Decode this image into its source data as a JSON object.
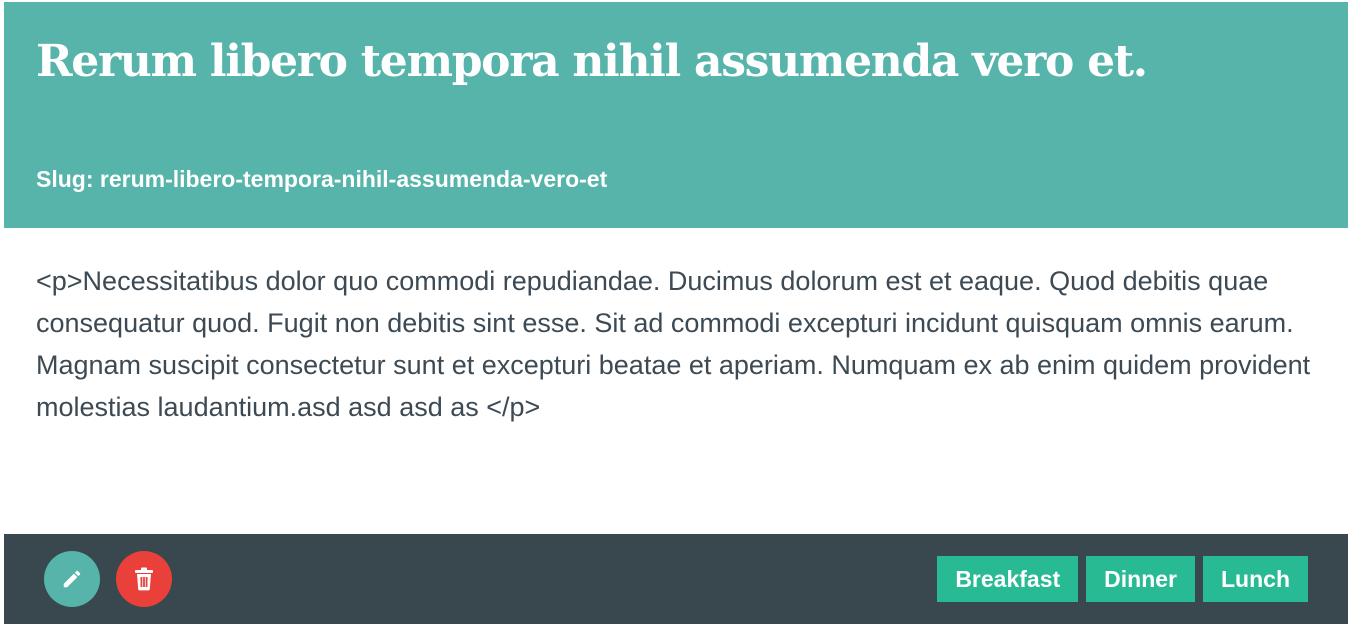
{
  "post": {
    "title": "Rerum libero tempora nihil assumenda vero et.",
    "slug_text": "Slug: rerum-libero-tempora-nihil-assumenda-vero-et",
    "body": "<p>Necessitatibus dolor quo commodi repudiandae. Ducimus dolorum est et eaque. Quod debitis quae consequatur quod. Fugit non debitis sint esse. Sit ad commodi excepturi incidunt quisquam omnis earum. Magnam suscipit consectetur sunt et excepturi beatae et aperiam. Numquam ex ab enim quidem provident molestias laudantium.asd asd asd as </p>"
  },
  "actions": {
    "edit_icon": "pencil-icon",
    "delete_icon": "trash-icon"
  },
  "tags": [
    "Breakfast",
    "Dinner",
    "Lunch"
  ],
  "colors": {
    "header": "#56b4aa",
    "footer": "#39474f",
    "edit": "#56b4aa",
    "delete": "#e9413a",
    "tag": "#27ba93",
    "body_text": "#3d4a53"
  }
}
